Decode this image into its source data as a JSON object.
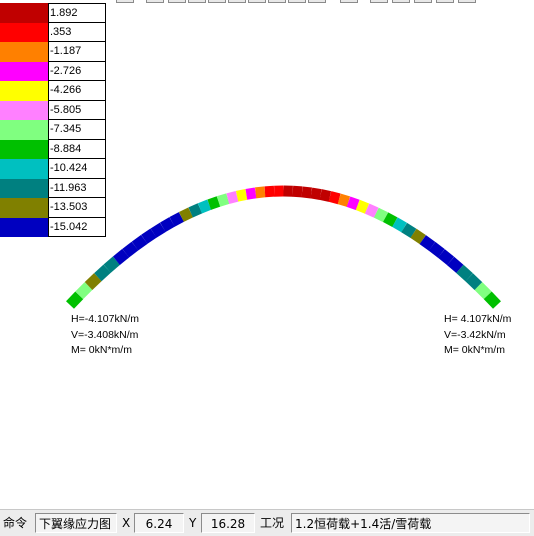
{
  "legend": {
    "items": [
      {
        "value": "1.892",
        "color": "#c00000"
      },
      {
        "value": ".353",
        "color": "#ff0000"
      },
      {
        "value": "-1.187",
        "color": "#ff8000"
      },
      {
        "value": "-2.726",
        "color": "#ff00ff"
      },
      {
        "value": "-4.266",
        "color": "#ffff00"
      },
      {
        "value": "-5.805",
        "color": "#ff80ff"
      },
      {
        "value": "-7.345",
        "color": "#80ff80"
      },
      {
        "value": "-8.884",
        "color": "#00c000"
      },
      {
        "value": "-10.424",
        "color": "#00c0c0"
      },
      {
        "value": "-11.963",
        "color": "#008080"
      },
      {
        "value": "-13.503",
        "color": "#808000"
      },
      {
        "value": "-15.042",
        "color": "#0000c0"
      }
    ]
  },
  "arch_segments": [
    "#00c000",
    "#80ff80",
    "#808000",
    "#008080",
    "#008080",
    "#0000c0",
    "#0000c0",
    "#0000c0",
    "#0000c0",
    "#0000c0",
    "#0000c0",
    "#0000c0",
    "#808000",
    "#008080",
    "#00c0c0",
    "#00c000",
    "#80ff80",
    "#ff80ff",
    "#ffff00",
    "#ff00ff",
    "#ff8000",
    "#ff0000",
    "#ff0000",
    "#c00000",
    "#c00000",
    "#c00000",
    "#c00000",
    "#c00000",
    "#ff0000",
    "#ff8000",
    "#ff00ff",
    "#ffff00",
    "#ff80ff",
    "#80ff80",
    "#00c000",
    "#00c0c0",
    "#008080",
    "#808000",
    "#0000c0",
    "#0000c0",
    "#0000c0",
    "#0000c0",
    "#008080",
    "#008080",
    "#80ff80",
    "#00c000"
  ],
  "reactions": {
    "left": {
      "h": "H=-4.107kN/m",
      "v": "V=-3.408kN/m",
      "m": "M= 0kN*m/m"
    },
    "right": {
      "h": "H= 4.107kN/m",
      "v": "V=-3.42kN/m",
      "m": "M= 0kN*m/m"
    }
  },
  "statusbar": {
    "command": "命令",
    "view": "下翼缘应力图",
    "x_label": "X",
    "x_value": "6.24",
    "y_label": "Y",
    "y_value": "16.28",
    "case_label": "工况",
    "case_value": "1.2恒荷载+1.4活/雪荷载"
  }
}
